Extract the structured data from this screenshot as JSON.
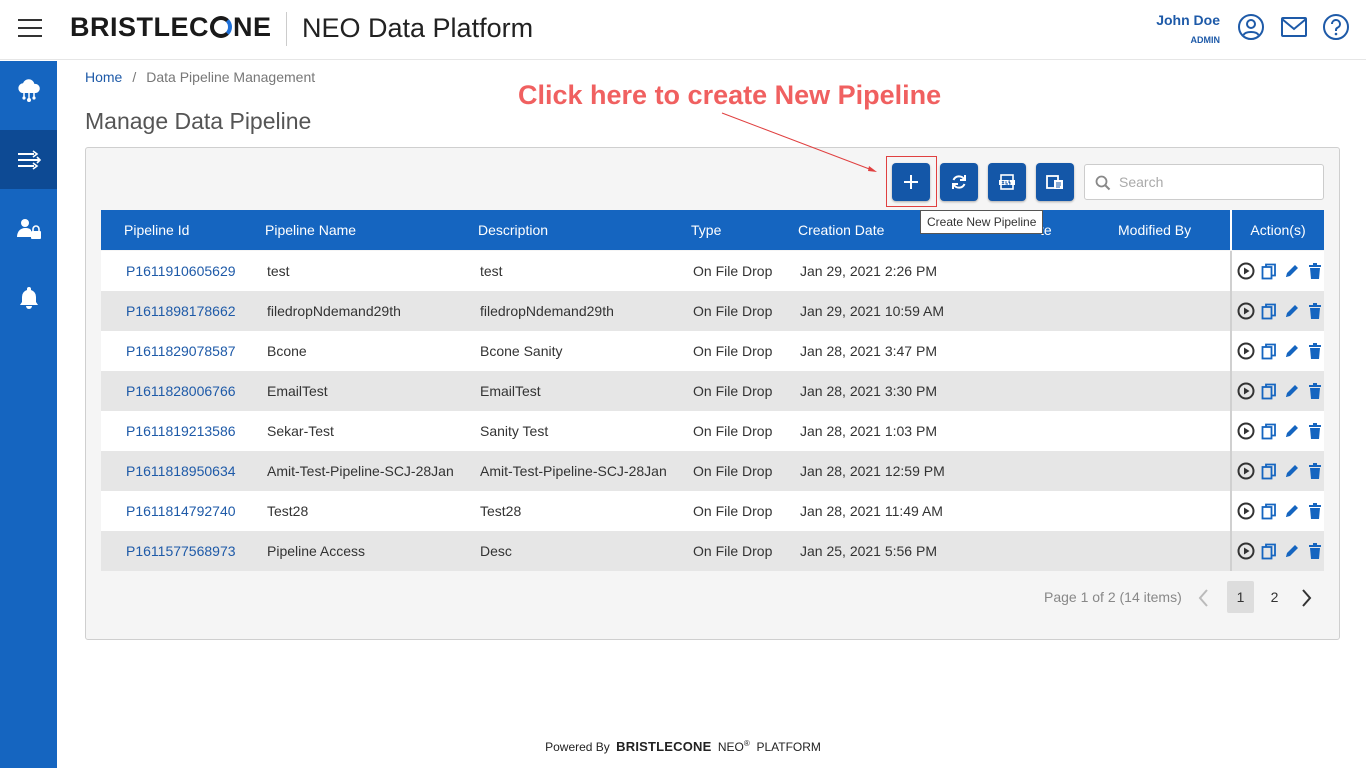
{
  "header": {
    "logo_text": "BRISTLECONE",
    "app_title": "NEO Data Platform",
    "user_name": "John Doe",
    "user_role": "ADMIN"
  },
  "sidebar": {
    "items": [
      {
        "icon": "cloud-network-icon",
        "active": false
      },
      {
        "icon": "pipeline-flow-icon",
        "active": true
      },
      {
        "icon": "user-lock-icon",
        "active": false
      },
      {
        "icon": "bell-icon",
        "active": false
      }
    ]
  },
  "breadcrumb": {
    "home": "Home",
    "separator": "/",
    "current": "Data Pipeline Management"
  },
  "page_title": "Manage Data Pipeline",
  "annotation": "Click here to create New Pipeline",
  "toolbar": {
    "tooltip": "Create New Pipeline",
    "search_placeholder": "Search"
  },
  "table": {
    "columns": [
      "Pipeline Id",
      "Pipeline Name",
      "Description",
      "Type",
      "Creation Date",
      "te",
      "Modified By",
      "Action(s)"
    ],
    "rows": [
      {
        "id": "P1611910605629",
        "name": "test",
        "description": "test",
        "type": "On File Drop",
        "created": "Jan 29, 2021 2:26 PM"
      },
      {
        "id": "P1611898178662",
        "name": "filedropNdemand29th",
        "description": "filedropNdemand29th",
        "type": "On File Drop",
        "created": "Jan 29, 2021 10:59 AM"
      },
      {
        "id": "P1611829078587",
        "name": "Bcone",
        "description": "Bcone Sanity",
        "type": "On File Drop",
        "created": "Jan 28, 2021 3:47 PM"
      },
      {
        "id": "P1611828006766",
        "name": "EmailTest",
        "description": "EmailTest",
        "type": "On File Drop",
        "created": "Jan 28, 2021 3:30 PM"
      },
      {
        "id": "P1611819213586",
        "name": "Sekar-Test",
        "description": "Sanity Test",
        "type": "On File Drop",
        "created": "Jan 28, 2021 1:03 PM"
      },
      {
        "id": "P1611818950634",
        "name": "Amit-Test-Pipeline-SCJ-28Jan",
        "description": "Amit-Test-Pipeline-SCJ-28Jan",
        "type": "On File Drop",
        "created": "Jan 28, 2021 12:59 PM"
      },
      {
        "id": "P1611814792740",
        "name": "Test28",
        "description": "Test28",
        "type": "On File Drop",
        "created": "Jan 28, 2021 11:49 AM"
      },
      {
        "id": "P1611577568973",
        "name": "Pipeline Access",
        "description": "Desc",
        "type": "On File Drop",
        "created": "Jan 25, 2021 5:56 PM"
      }
    ]
  },
  "pagination": {
    "info": "Page 1 of 2 (14 items)",
    "pages": [
      "1",
      "2"
    ],
    "current": "1"
  },
  "footer": {
    "powered_by": "Powered By",
    "brand": "BRISTLECONE",
    "neo": "NEO",
    "reg": "®",
    "platform": "PLATFORM"
  },
  "colors": {
    "primary": "#1565c0",
    "link": "#1e5aa8",
    "annotation": "#f06060"
  }
}
